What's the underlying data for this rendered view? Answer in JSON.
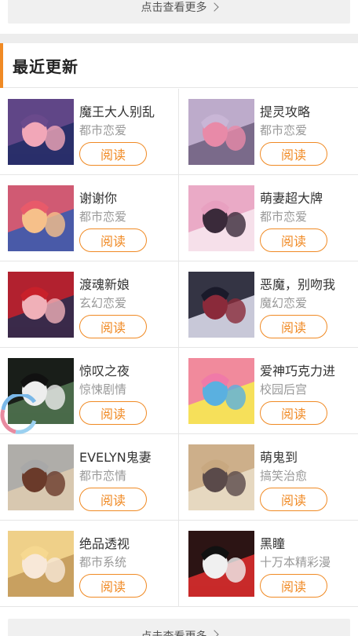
{
  "top_more": {
    "label": "点击查看更多"
  },
  "section": {
    "title": "最近更新"
  },
  "read_label": "阅读",
  "comics": [
    {
      "name": "魔王大人别乱",
      "genre": "都市恋爱",
      "palette": [
        "#6a4a8c",
        "#f2a7b8",
        "#2a2f6a"
      ]
    },
    {
      "name": "提灵攻略",
      "genre": "都市恋爱",
      "palette": [
        "#c9b6d6",
        "#e88aa8",
        "#7a6a8a"
      ]
    },
    {
      "name": "谢谢你",
      "genre": "都市恋爱",
      "palette": [
        "#e85a6a",
        "#f6c08a",
        "#4a5aa8"
      ]
    },
    {
      "name": "萌妻超大牌",
      "genre": "都市恋爱",
      "palette": [
        "#e8a0c0",
        "#3a2a3a",
        "#f6e0ea"
      ]
    },
    {
      "name": "渡魂新娘",
      "genre": "玄幻恋爱",
      "palette": [
        "#c8202a",
        "#f0b0b8",
        "#3a2a4a"
      ]
    },
    {
      "name": "恶魔，别吻我",
      "genre": "魔幻恋爱",
      "palette": [
        "#1a1a2a",
        "#8a2a3a",
        "#c8c8d8"
      ]
    },
    {
      "name": "惊叹之夜",
      "genre": "惊悚剧情",
      "palette": [
        "#111111",
        "#eeeeee",
        "#4a6a4a"
      ]
    },
    {
      "name": "爱神巧克力进",
      "genre": "校园后宫",
      "palette": [
        "#f07aa8",
        "#5ab0e0",
        "#f6e05a"
      ]
    },
    {
      "name": "EVELYN鬼妻",
      "genre": "都市恋情",
      "palette": [
        "#a8a8a8",
        "#6a3a2a",
        "#d8c8b0"
      ]
    },
    {
      "name": "萌鬼到",
      "genre": "搞笑治愈",
      "palette": [
        "#c8a880",
        "#5a4a4a",
        "#e6d8c0"
      ]
    },
    {
      "name": "绝品透视",
      "genre": "都市系统",
      "palette": [
        "#f6d890",
        "#f8e8d8",
        "#c8a060"
      ]
    },
    {
      "name": "黑瞳",
      "genre": "十万本精彩漫",
      "palette": [
        "#111111",
        "#f0f0f0",
        "#c82a2a"
      ]
    }
  ],
  "bottom_more": {
    "label": "点击查看更多"
  },
  "colors": {
    "accent": "#f08a24",
    "divider": "#e6e6e6",
    "text": "#333333",
    "subtext": "#999999"
  }
}
